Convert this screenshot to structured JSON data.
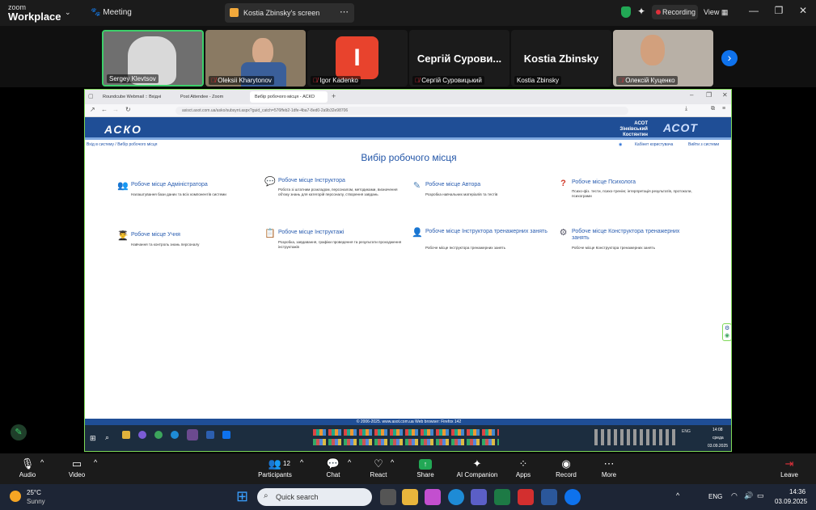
{
  "zoom": {
    "brand_small": "zoom",
    "brand": "Workplace",
    "meeting": "Meeting",
    "share_tab": "Kostia Zbinsky's screen",
    "recording": "Recording",
    "view": "View"
  },
  "participants": [
    {
      "name": "Sergey Klevtsov",
      "initial": "",
      "big": ""
    },
    {
      "name": "Oleksii Kharytonov",
      "initial": "",
      "big": ""
    },
    {
      "name": "Igor Kadenko",
      "initial": "I",
      "big": ""
    },
    {
      "name": "Сергій Суровицький",
      "initial": "",
      "big": "Сергій Сурови..."
    },
    {
      "name": "Kostia Zbinsky",
      "initial": "",
      "big": "Kostia Zbinsky"
    },
    {
      "name": "Олексій Куценко",
      "initial": "",
      "big": ""
    }
  ],
  "browser": {
    "tabs": [
      "Roundcube Webmail :: Вхідні",
      "Post Attendee - Zoom",
      "Вибір робочого місця - АСКО"
    ],
    "url": "asisct.asot.com.ua/asko/subsynt.aspx?guid_catch=576ffeb2-1dfe-4ba7-8ed0-2a9b32e98706"
  },
  "site": {
    "logo_left": "АСКО",
    "org1": "АСОТ",
    "org2": "Зінківський Костянтин",
    "logo_right": "АСОТ",
    "breadcrumb": "Вхід в систему / Вибір робочого місця",
    "cabinet": "Кабінет користувача",
    "logout": "Вийти з системи",
    "title": "Вибір робочого місця",
    "footer": "© 2006-2025.  www.asot.com.ua  Web browser: Firefox 142"
  },
  "workplaces": [
    {
      "title": "Робоче місце Адміністратора",
      "desc": "Налаштування бази даних та всіх компонентів системи",
      "icon": "admin-icon"
    },
    {
      "title": "Робоче місце Інструктора",
      "desc": "Робота зі штатним розкладом, персоналом, методиками, визначення об'єму знань для категорій персоналу, створення завдань",
      "icon": "instructor-icon"
    },
    {
      "title": "Робоче місце Автора",
      "desc": "Розробка навчальних матеріалів та тестів",
      "icon": "author-icon"
    },
    {
      "title": "Робоче місце Психолога",
      "desc": "Психо-фіз. тести, психо-тренінг, інтерпретація результатів, протоколи, психограми",
      "icon": "psychologist-icon"
    },
    {
      "title": "Робоче місце Учня",
      "desc": "Навчання та контроль знань персоналу",
      "icon": "student-icon"
    },
    {
      "title": "Робоче місце Інструктажі",
      "desc": "Розробка, завдавання, графіки проведення та результати проходження інструктажів",
      "icon": "briefing-icon"
    },
    {
      "title": "Робоче місце Інструктора тренажерних занять",
      "desc": "Робоче місце Інструктора тренажерних занять",
      "icon": "trainer-instructor-icon"
    },
    {
      "title": "Робоче місце Конструктора тренажерних занять",
      "desc": "Робоче місце Конструктора тренажерних занять",
      "icon": "trainer-constructor-icon"
    }
  ],
  "remote_taskbar": {
    "time": "14:08",
    "day": "среда",
    "date": "03.09.2025",
    "lang": "ENG"
  },
  "controls": {
    "audio": "Audio",
    "video": "Video",
    "participants": "Participants",
    "participants_count": "12",
    "chat": "Chat",
    "react": "React",
    "share": "Share",
    "ai": "AI Companion",
    "apps": "Apps",
    "record": "Record",
    "more": "More",
    "leave": "Leave"
  },
  "taskbar": {
    "temp": "25°C",
    "weather": "Sunny",
    "search": "Quick search",
    "lang": "ENG",
    "time": "14:36",
    "date": "03.09.2025"
  },
  "colors": {
    "accent_green": "#7ed957",
    "site_blue": "#1f4e96",
    "share_green": "#22a855",
    "leave_red": "#e0303b"
  }
}
